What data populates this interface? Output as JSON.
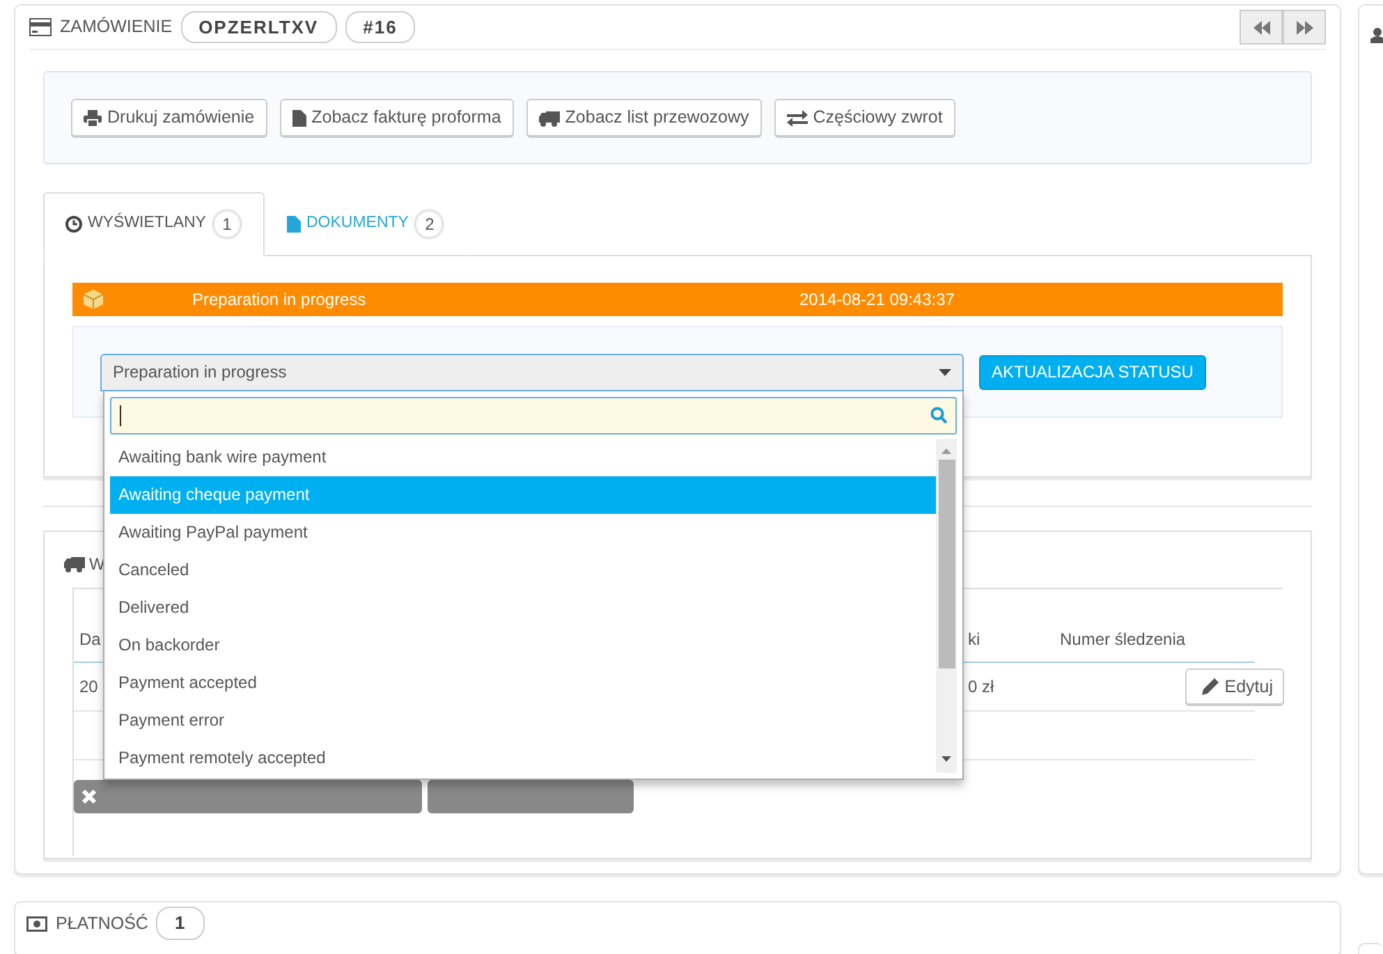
{
  "order_panel": {
    "title": "ZAMÓWIENIE",
    "reference": "OPZERLTXV",
    "number": "#16"
  },
  "actions": [
    {
      "label": "Drukuj zamówienie",
      "kind": "print"
    },
    {
      "label": "Zobacz fakturę proforma",
      "kind": "file"
    },
    {
      "label": "Zobacz list przewozowy",
      "kind": "truck"
    },
    {
      "label": "Częściowy zwrot",
      "kind": "exchange"
    }
  ],
  "tabs": [
    {
      "label": "WYŚWIETLANY",
      "count": "1",
      "kind": "clock",
      "selected": true
    },
    {
      "label": "DOKUMENTY",
      "count": "2",
      "kind": "file",
      "selected": false
    }
  ],
  "status_history": [
    {
      "status": "Preparation in progress",
      "date": "2014-08-21 09:43:37",
      "color": "#ff8c00"
    }
  ],
  "status_select": {
    "value": "Preparation in progress",
    "expanded": true
  },
  "status_button": "AKTUALIZACJA STATUSU",
  "status_options": [
    {
      "label": "Awaiting bank wire payment",
      "selected": false
    },
    {
      "label": "Awaiting cheque payment",
      "selected": true
    },
    {
      "label": "Awaiting PayPal payment",
      "selected": false
    },
    {
      "label": "Canceled",
      "selected": false
    },
    {
      "label": "Delivered",
      "selected": false
    },
    {
      "label": "On backorder",
      "selected": false
    },
    {
      "label": "Payment accepted",
      "selected": false
    },
    {
      "label": "Payment error",
      "selected": false
    },
    {
      "label": "Payment remotely accepted",
      "selected": false
    }
  ],
  "shipping": {
    "title": "W",
    "columns": [
      "Da",
      "ki",
      "Numer śledzenia"
    ],
    "rows": [
      {
        "cells": [
          "20",
          "0 zł",
          ""
        ],
        "action": "Edytuj"
      }
    ]
  },
  "payment_panel": {
    "title": "PŁATNOŚĆ",
    "count": "1"
  }
}
